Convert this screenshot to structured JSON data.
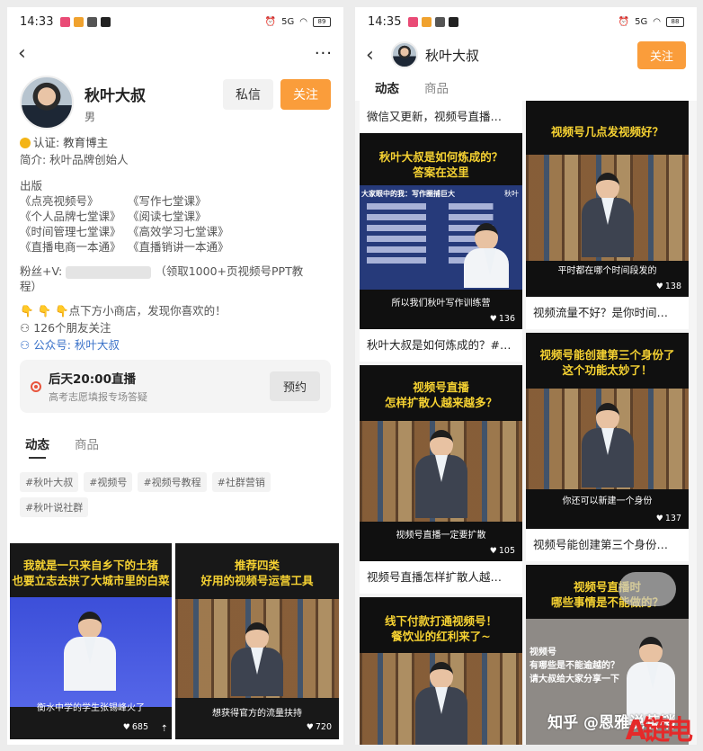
{
  "left": {
    "status": {
      "time": "14:33",
      "net": "5G",
      "battery": "89"
    },
    "profile": {
      "name": "秋叶大叔",
      "gender": "男",
      "message_label": "私信",
      "follow_label": "关注"
    },
    "bio": {
      "cert": "认证: 教育博主",
      "intro": "简介: 秋叶品牌创始人",
      "out": "出版",
      "books": [
        "《点亮视频号》",
        "《写作七堂课》",
        "《个人品牌七堂课》",
        "《阅读七堂课》",
        "《时间管理七堂课》",
        "《高效学习七堂课》",
        "《直播电商一本通》",
        "《直播销讲一本通》"
      ],
      "fans_prefix": "粉丝+V:",
      "fans_suffix": "（领取1000+页视频号PPT教",
      "fans_suffix2": "程）",
      "shop": "点下方小商店，发现你喜欢的！",
      "friends": "126个朋友关注",
      "gzh": "公众号: 秋叶大叔"
    },
    "live": {
      "title": "后天20:00直播",
      "desc": "高考志愿填报专场答疑",
      "button": "预约"
    },
    "tabs": [
      "动态",
      "商品"
    ],
    "tags": [
      "#秋叶大叔",
      "#视频号",
      "#视频号教程",
      "#社群营销",
      "#秋叶说社群"
    ],
    "videos": [
      {
        "caption": [
          "我就是一只来自乡下的土猪",
          "也要立志去拱了大城市里的白菜"
        ],
        "sub": "衡水中学的学生张锡峰火了",
        "likes": "685"
      },
      {
        "caption": [
          "推荐四类",
          "好用的视频号运营工具"
        ],
        "sub": "想获得官方的流量扶持",
        "likes": "720"
      }
    ]
  },
  "right": {
    "status": {
      "time": "14:35",
      "net": "5G",
      "battery": "88"
    },
    "header": {
      "name": "秋叶大叔",
      "follow_label": "关注"
    },
    "tabs": [
      "动态",
      "商品"
    ],
    "col1": [
      {
        "title": "微信又更新，视频号直播…"
      },
      {
        "caption": [
          "秋叶大叔是如何炼成的？",
          "答案在这里"
        ],
        "slide_title": "大家眼中的我：写作圈捕巨大",
        "slide_brand": "秋叶",
        "sub": "所以我们秋叶写作训练营",
        "likes": "136",
        "title": "秋叶大叔是如何炼成的？#…"
      },
      {
        "caption": [
          "视频号直播",
          "怎样扩散人越来越多？"
        ],
        "sub": "视频号直播一定要扩散",
        "likes": "105",
        "title": "视频号直播怎样扩散人越…"
      },
      {
        "caption": [
          "线下付款打通视频号！",
          "餐饮业的红利来了~"
        ]
      }
    ],
    "col2": [
      {
        "caption": [
          "视频号几点发视频好？"
        ],
        "sub": "平时都在哪个时间段发的",
        "likes": "138",
        "title": "视频流量不好？是你时间…"
      },
      {
        "caption": [
          "视频号能创建第三个身份了",
          "这个功能太妙了！"
        ],
        "sub": "你还可以新建一个身份",
        "likes": "137",
        "title": "视频号能创建第三个身份…"
      },
      {
        "caption": [
          "视频号直播时",
          "哪些事情是不能做的？"
        ],
        "slide_lines": [
          "视频号",
          "有哪些是不能逾越的？",
          "请大叔给大家分享一下"
        ]
      }
    ],
    "watermark": "知乎 @恩雅说营销",
    "logo": "A链电"
  }
}
